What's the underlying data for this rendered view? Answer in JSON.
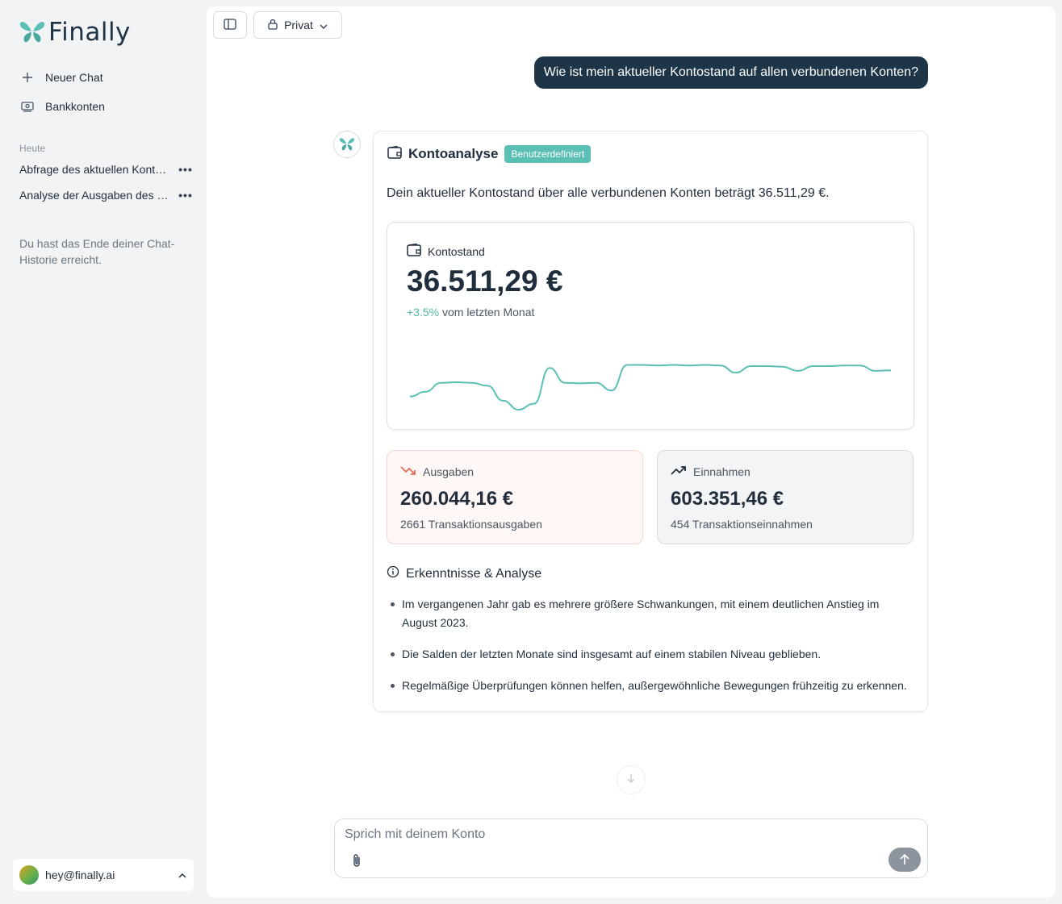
{
  "app": {
    "name": "Finally"
  },
  "sidebar": {
    "new_chat": "Neuer Chat",
    "bank_accounts": "Bankkonten",
    "section_label": "Heute",
    "history": [
      {
        "label": "Abfrage des aktuellen Kontostands"
      },
      {
        "label": "Analyse der Ausgaben des letzten Monats"
      }
    ],
    "end_note": "Du hast das Ende deiner Chat-Historie erreicht.",
    "user_email": "hey@finally.ai"
  },
  "toolbar": {
    "visibility_label": "Privat"
  },
  "conversation": {
    "user_message": "Wie ist mein aktueller Kontostand auf allen verbundenen Konten?",
    "card": {
      "title": "Kontoanalyse",
      "badge": "Benutzerdefiniert",
      "intro": "Dein aktueller Kontostand über alle verbundenen Konten beträgt 36.511,29 €.",
      "balance_label": "Kontostand",
      "balance_value": "36.511,29 €",
      "change_value": "+3.5%",
      "change_text": "vom letzten Monat",
      "expenses": {
        "label": "Ausgaben",
        "value": "260.044,16 €",
        "sub": "2661 Transaktionsausgaben"
      },
      "income": {
        "label": "Einnahmen",
        "value": "603.351,46 €",
        "sub": "454 Transaktionseinnahmen"
      },
      "insights_title": "Erkenntnisse & Analyse",
      "insights": [
        "Im vergangenen Jahr gab es mehrere größere Schwankungen, mit einem deutlichen Anstieg im August 2023.",
        "Die Salden der letzten Monate sind insgesamt auf einem stabilen Niveau geblieben.",
        "Regelmäßige Überprüfungen können helfen, außergewöhnliche Bewegungen frühzeitig zu erkennen."
      ]
    }
  },
  "composer": {
    "placeholder": "Sprich mit deinem Konto"
  },
  "colors": {
    "accent": "#5bbfb5",
    "user_bubble": "#1e3548",
    "expense": "#e86a5a"
  },
  "chart_data": {
    "type": "line",
    "values": [
      0.22,
      0.3,
      0.45,
      0.46,
      0.45,
      0.4,
      0.15,
      0.0,
      0.1,
      0.7,
      0.45,
      0.44,
      0.45,
      0.32,
      0.75,
      0.75,
      0.74,
      0.75,
      0.74,
      0.75,
      0.74,
      0.62,
      0.73,
      0.73,
      0.72,
      0.65,
      0.73,
      0.73,
      0.74,
      0.74,
      0.65,
      0.66
    ]
  }
}
